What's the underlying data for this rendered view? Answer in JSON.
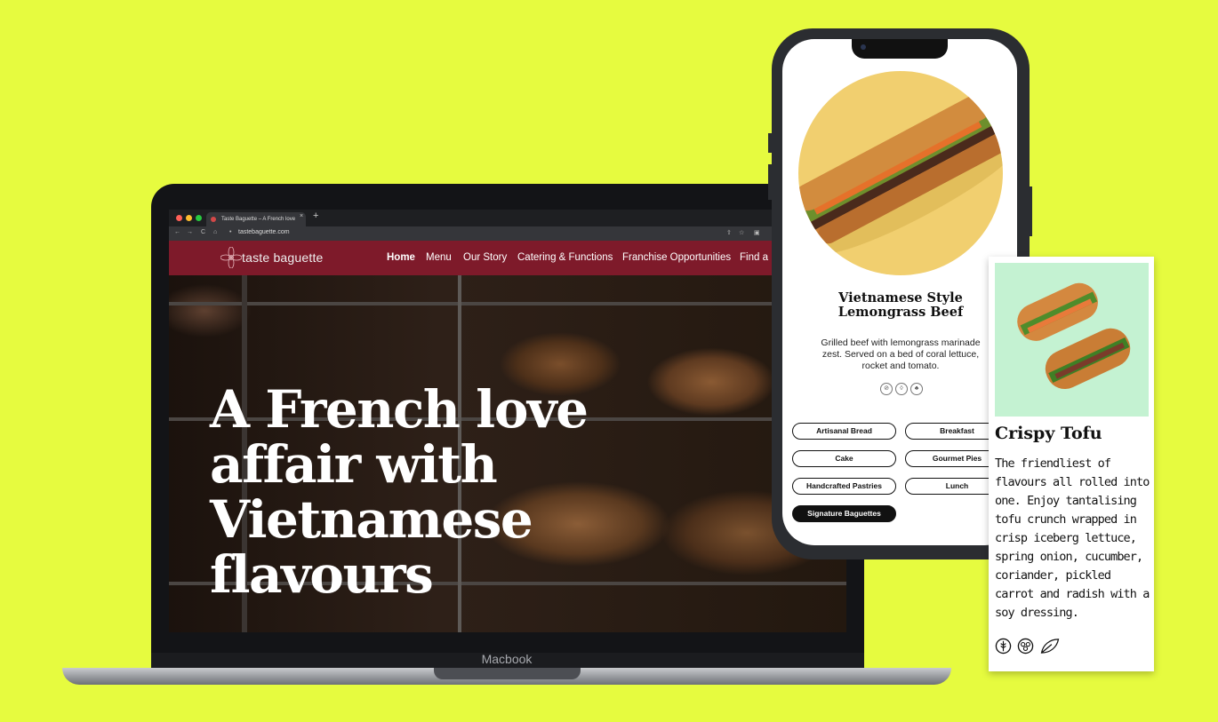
{
  "browser": {
    "tab_title": "Taste Baguette – A French love",
    "tab_close": "×",
    "new_tab": "+",
    "url": "tastebaguette.com",
    "traffic_colors": [
      "#ff5f57",
      "#febc2e",
      "#28c840"
    ]
  },
  "site": {
    "logo_text": "taste baguette",
    "brand_color": "#7e1a2a",
    "nav": [
      "Home",
      "Menu",
      "Our Story",
      "Catering & Functions",
      "Franchise Opportunities",
      "Find a"
    ],
    "active_nav": "Home",
    "hero_lines": [
      "A French love",
      "affair with",
      "Vietnamese",
      "flavours"
    ]
  },
  "device_label": "Macbook",
  "phone": {
    "title_lines": [
      "Vietnamese Style",
      "Lemongrass Beef"
    ],
    "description": "Grilled beef with lemongrass marinade zest. Served on a bed of coral lettuce, rocket and tomato.",
    "diet_icons": [
      "gluten-icon",
      "dairy-icon",
      "vegetable-icon"
    ],
    "categories": [
      "Artisanal Bread",
      "Breakfast",
      "Cake",
      "Gourmet Pies",
      "Handcrafted Pastries",
      "Lunch",
      "Signature Baguettes"
    ],
    "active_category": "Signature Baguettes"
  },
  "card": {
    "title": "Crispy Tofu",
    "description": "The friendliest of flavours all rolled into one. Enjoy tantalising tofu crunch wrapped in crisp iceberg lettuce, spring onion, cucumber, coriander, pickled carrot and radish with a soy dressing.",
    "icons": [
      "wheat-icon",
      "nut-icon",
      "leaf-icon"
    ]
  },
  "colors": {
    "background": "#e6fb3f",
    "card_image_bg": "#c4f2d2",
    "phone_circle": "#f1cf6f"
  }
}
